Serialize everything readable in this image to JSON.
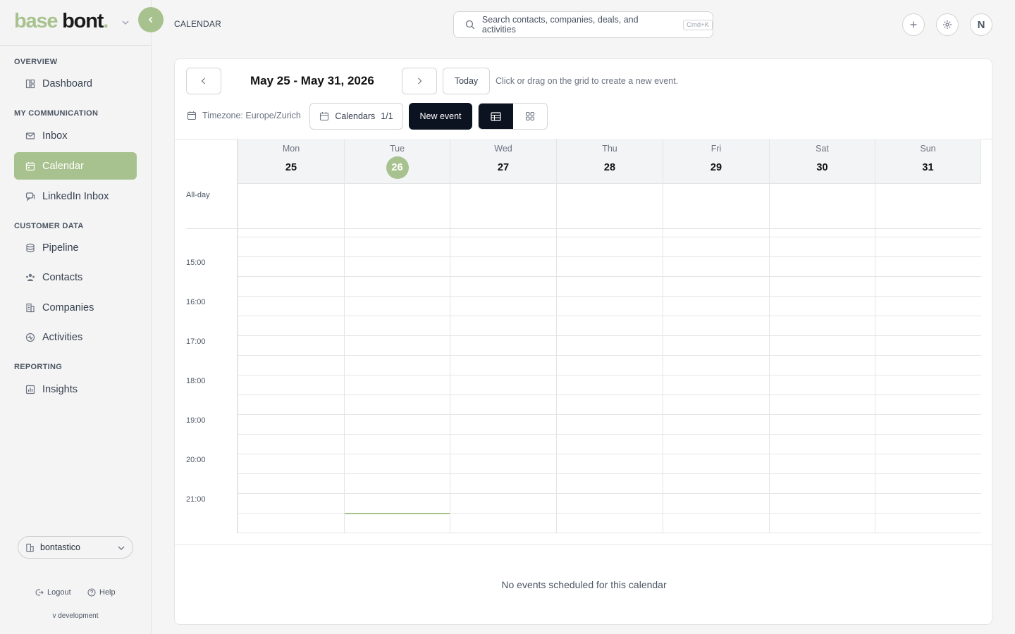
{
  "logo": {
    "part1": "base",
    "part2": "bont",
    "dot": "."
  },
  "sidebar": {
    "sections": [
      {
        "label": "OVERVIEW"
      },
      {
        "label": "MY COMMUNICATION"
      },
      {
        "label": "CUSTOMER DATA"
      },
      {
        "label": "REPORTING"
      }
    ],
    "items": [
      {
        "label": "Dashboard",
        "icon": "dashboard-icon"
      },
      {
        "label": "Inbox",
        "icon": "mail-icon"
      },
      {
        "label": "Calendar",
        "icon": "calendar-icon",
        "active": true
      },
      {
        "label": "LinkedIn Inbox",
        "icon": "chat-icon"
      },
      {
        "label": "Pipeline",
        "icon": "database-icon"
      },
      {
        "label": "Contacts",
        "icon": "users-icon"
      },
      {
        "label": "Companies",
        "icon": "building-icon"
      },
      {
        "label": "Activities",
        "icon": "activity-icon"
      },
      {
        "label": "Insights",
        "icon": "chart-icon"
      }
    ],
    "org": "bontastico",
    "logout": "Logout",
    "help": "Help",
    "version": "v development"
  },
  "header": {
    "title": "CALENDAR",
    "search_placeholder": "Search contacts, companies, deals, and activities",
    "search_shortcut": "Cmd+K",
    "avatar_initial": "N"
  },
  "calendar": {
    "range": "May 25 - May 31, 2026",
    "today_label": "Today",
    "hint": "Click or drag on the grid to create a new event.",
    "timezone": "Timezone: Europe/Zurich",
    "calendars_label": "Calendars",
    "calendars_count": "1/1",
    "new_event": "New event",
    "allday_label": "All-day",
    "days": [
      {
        "name": "Mon",
        "num": "25"
      },
      {
        "name": "Tue",
        "num": "26",
        "today": true
      },
      {
        "name": "Wed",
        "num": "27"
      },
      {
        "name": "Thu",
        "num": "28"
      },
      {
        "name": "Fri",
        "num": "29"
      },
      {
        "name": "Sat",
        "num": "30"
      },
      {
        "name": "Sun",
        "num": "31"
      }
    ],
    "hours": [
      "15:00",
      "16:00",
      "17:00",
      "18:00",
      "19:00",
      "20:00",
      "21:00"
    ],
    "empty_message": "No events scheduled for this calendar"
  },
  "colors": {
    "accent": "#a8c28f",
    "dark": "#0b1220"
  }
}
